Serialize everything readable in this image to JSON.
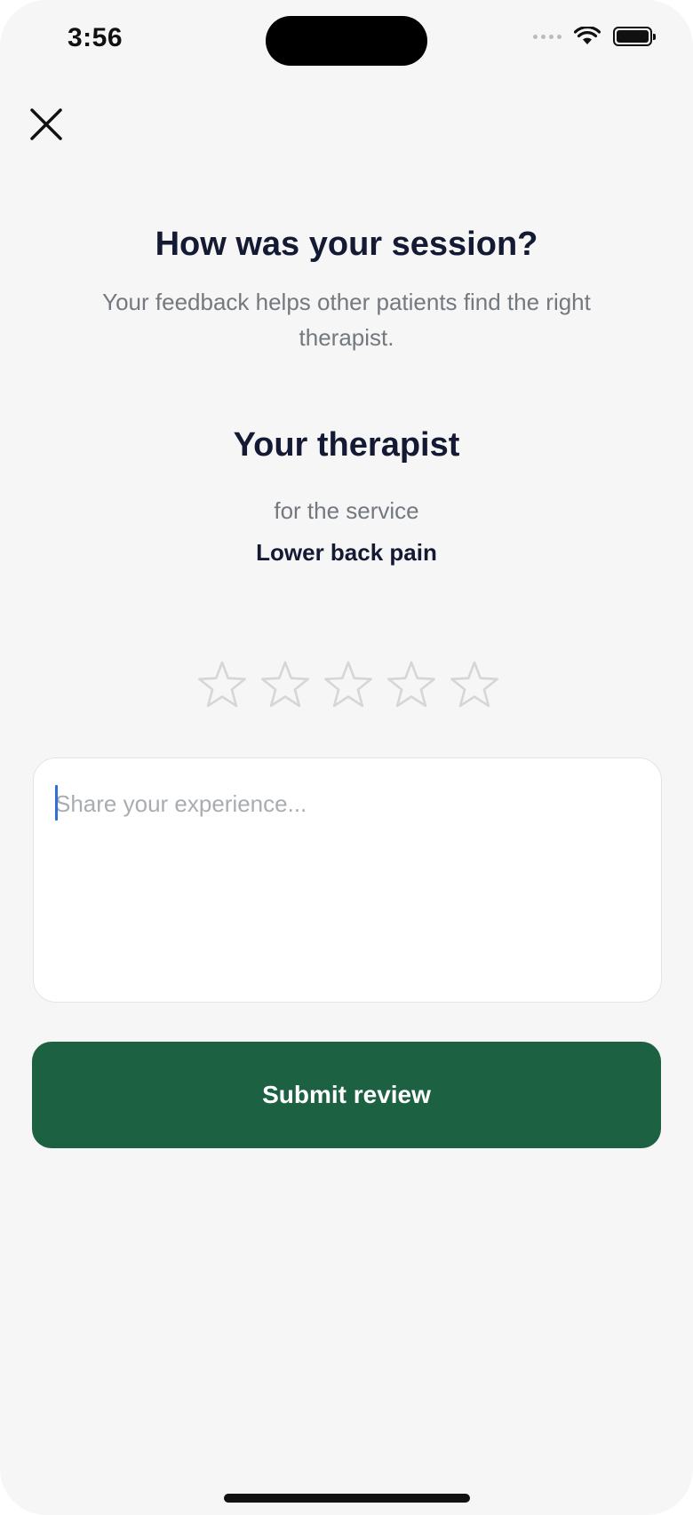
{
  "status_bar": {
    "time": "3:56",
    "icons": [
      "signal-icon",
      "wifi-icon",
      "battery-icon"
    ]
  },
  "header": {
    "close_icon": "close-icon"
  },
  "intro": {
    "title": "How was your session?",
    "subtitle": "Your feedback helps other patients find the right therapist."
  },
  "therapist": {
    "heading": "Your therapist",
    "service_caption": "for the service",
    "service_name": "Lower back pain"
  },
  "rating": {
    "max": 5,
    "value": 0,
    "icon": "star-outline-icon"
  },
  "review": {
    "placeholder": "Share your experience...",
    "value": ""
  },
  "actions": {
    "submit_label": "Submit review"
  },
  "colors": {
    "background": "#f5f6f5",
    "primary": "#1c6142",
    "heading": "#141a33",
    "muted": "#74787f",
    "star_outline": "#d4d6d8",
    "caret": "#2f6fdb"
  }
}
